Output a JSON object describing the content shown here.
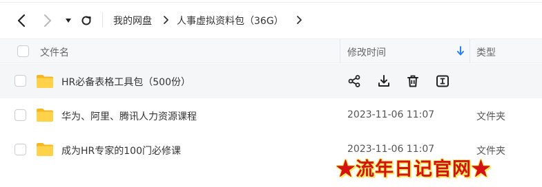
{
  "breadcrumb": {
    "items": [
      "我的网盘",
      "人事虚拟资料包（36G）"
    ]
  },
  "table": {
    "headers": {
      "name": "文件名",
      "modified": "修改时间",
      "type": "类型"
    },
    "rows": [
      {
        "name": "HR必备表格工具包（500份）",
        "modified": "",
        "type": ""
      },
      {
        "name": "华为、阿里、腾讯人力资源课程",
        "modified": "2023-11-06 11:07",
        "type": "文件夹"
      },
      {
        "name": "成为HR专家的100门必修课",
        "modified": "2023-11-06 11:07",
        "type": "文件夹"
      }
    ]
  },
  "row_actions": [
    "share-icon",
    "download-icon",
    "delete-icon",
    "rename-icon"
  ],
  "watermark": "★流年日记官网★",
  "colors": {
    "accent": "#2a7ff3",
    "folder": "#ffc93c",
    "hover_row": "#f5f6f8",
    "watermark": "#d41212"
  }
}
